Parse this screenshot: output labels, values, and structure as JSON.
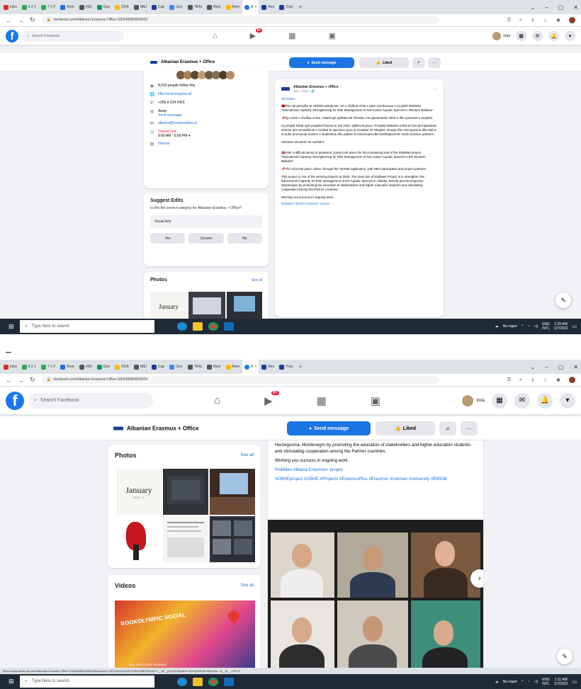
{
  "browser": {
    "tabs": [
      "Inbo",
      "6 2 1",
      "7 1 F",
      "Rem",
      "(49)",
      "Goo",
      "DOK",
      "MEI",
      "Cap",
      "Goo",
      "TRAI",
      "Rom",
      "Rem",
      "A",
      "Ann",
      "Tran"
    ],
    "close_tab_glyph": "×",
    "new_tab_glyph": "+",
    "window_controls": [
      "⌄",
      "–",
      "▢",
      "✕"
    ],
    "url_1": "facebook.com/Albanian-Erasmus-Office-105548080904543/",
    "url_2": "facebook.com/Albanian-Erasmus-Office-105548080904543/",
    "status_url": "https://www.facebook.com/Albanian-Erasmus-Office-105548080904543/photos/pcb.196100011120197/196103587800167/?__cft__[0]=AZVWp8LkVJ2rKqSeWJEvt0hCe4w...&__tn__=*bH-R"
  },
  "facebook": {
    "logo_glyph": "f",
    "search_placeholder": "Search Facebook",
    "nav_badge": "9+",
    "user_name": "Irida",
    "page_name": "Albanian Erasmus + Office",
    "send_message": "Send message",
    "liked": "Liked",
    "more_glyph": "···",
    "search_glyph": "⌕"
  },
  "intro": {
    "followers": "8,023 people follow this",
    "website": "http://erasmusplus.al/",
    "phone": "+355 4 224 0415",
    "status": "Away",
    "send_message": "Send message",
    "email": "albania@erasmusplus.al",
    "hours_status": "Closed now",
    "hours": "9:00 AM - 5:00 PM",
    "category": "Interest"
  },
  "suggest": {
    "title": "Suggest Edits",
    "question": "Is this the correct category for Albanian Erasmus + Office?",
    "category_value": "Visual Arts",
    "yes": "Yes",
    "unsure": "Unsure",
    "no": "No"
  },
  "photos": {
    "title": "Photos",
    "see_all": "See all",
    "calendar_title": "January",
    "calendar_sub": "2022 · 1"
  },
  "videos": {
    "title": "Videos",
    "see_all": "See all",
    "thumb_text": "BOOKOLYMPIC SOCIAL",
    "thumb_sub": "2021 EDMOTORS DRAWING"
  },
  "post": {
    "author": "Albanian Erasmus + Office",
    "date": "July 7, 2021 · 🌐",
    "hashtag_top": "#RiskMan",
    "p1": "🇦🇱Pas një periudhe të vështirë pandemie, sot u zhvillua vizita e parë monitoruese e projektit RiskMan \"Educational Capacity Strengthening for Risk Management of Non-native Aquatic Species in Western Balkans\".",
    "p2": "📌Kjo vizitë u zhvillua online, nëpërmjet aplikacionit TEAMS, me pjesëmarrës NEO-n dhe partnerët e projektit.",
    "p3": "Ky projekt është njëri projektet fituese të vitit 2020. Qëllimi kryesor i Projektit RiskMan është të forcojë kapacitetin arsimor për menaxhimin e rrezikut të specieve ujore jo-vendase në Shqipëri, Bosnje dhe Hercegovinë dhe Mal të Zi duke promovuar arsimin e studentëve dhe palëve të interesuara dhe bashkëpunimin midis vendeve partnere.",
    "p4": "Suksese në punën në vazhdim.",
    "p5": "🇬🇧After a difficult period of pandemic, today took place the first monitoring visit of the RiskMan project \"Educational Capacity Strengthening for Risk Management of Non-native Aquatic Species in the Western Balkans\".",
    "p6": "📌The visit took place online, through the TEAMS application, with NEO participants and project partners.",
    "p7": "This project is one of the winning projects at 2020. The main aim of RiskMan Project is to strengthen the Educational Capacity for Risk Management of NN Aquatic Species in Albania, Bosnia and Herzegovina, Montenegro by promoting the education of stakeholders and higher education students and stimulating cooperation among the Partner countries.",
    "p8": "Wishing you success in ongoing work.",
    "link": "RiskMan Albania Erasmus+ project",
    "p2_top": "Herzegovina, Montenegro by promoting the education of stakeholders and higher education students and stimulating cooperation among the Partner countries.",
    "hashtags": "#CBHEproject #CBHE #Projects #ErasmusPlus #Erasmus #riskman #university #EMOM"
  },
  "taskbar": {
    "search_placeholder": "Type here to search",
    "weather": "No rogen",
    "lang": "ENG",
    "lang_sub": "INTL",
    "time_1": "1:20 AM",
    "date_1": "1/7/2022",
    "time_2": "1:11 AM",
    "date_2": "1/7/2022"
  },
  "separator": "–",
  "colors": {
    "fb_blue": "#1877f2",
    "button_blue": "#1b74e4",
    "link": "#216fdb",
    "taskbar": "#1f2a38"
  }
}
